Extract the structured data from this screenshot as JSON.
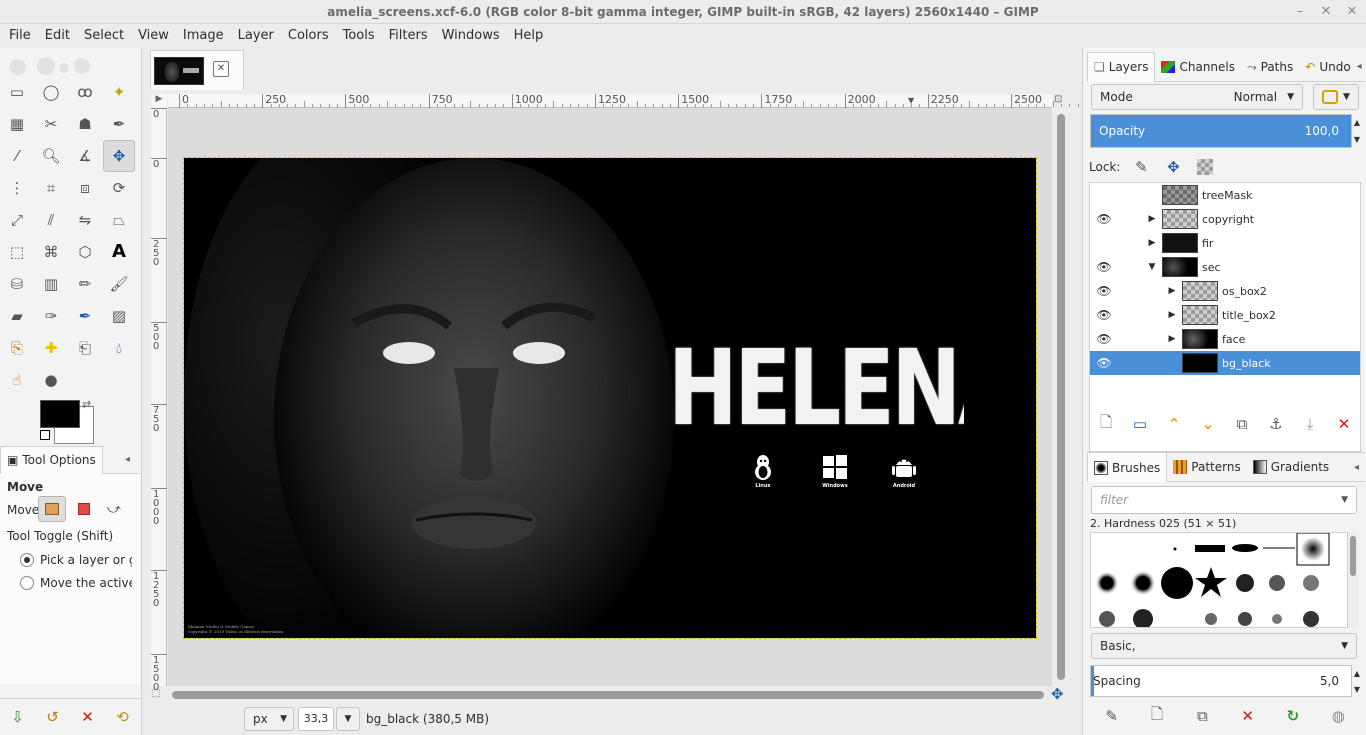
{
  "window": {
    "title": "amelia_screens.xcf-6.0 (RGB color 8-bit gamma integer, GIMP built-in sRGB, 42 layers) 2560x1440 – GIMP",
    "controls": [
      "–",
      "✕",
      "✕"
    ]
  },
  "menubar": [
    "File",
    "Edit",
    "Select",
    "View",
    "Image",
    "Layer",
    "Colors",
    "Tools",
    "Filters",
    "Windows",
    "Help"
  ],
  "toolbox": {
    "tools": [
      "rect-select",
      "ellipse-select",
      "free-select",
      "fuzzy-select",
      "select-by-color",
      "scissors",
      "foreground-select",
      "paths",
      "color-picker",
      "zoom",
      "measure",
      "move",
      "align",
      "crop",
      "unified-transform",
      "rotate",
      "scale",
      "shear",
      "flip",
      "perspective",
      "3d-transform",
      "warp",
      "cage",
      "text",
      "bucket-fill",
      "gradient",
      "pencil",
      "paintbrush",
      "eraser",
      "airbrush",
      "ink",
      "mypaint-brush",
      "clone",
      "heal",
      "perspective-clone",
      "blur",
      "smudge",
      "dodge-burn"
    ],
    "active_tool": "move"
  },
  "tool_options": {
    "tab_label": "Tool Options",
    "title": "Move",
    "move_label": "Move:",
    "toggle_label": "Tool Toggle  (Shift)",
    "options": [
      "Pick a layer or guide",
      "Move the active layer"
    ],
    "selected_option": 0
  },
  "image_tab": {
    "close": "✕"
  },
  "ruler": {
    "h_labels": [
      "0",
      "250",
      "500",
      "750",
      "1000",
      "1250",
      "1500",
      "1750",
      "2000",
      "2250",
      "2500"
    ],
    "v_labels": [
      "0",
      "0",
      "2\n5\n0",
      "5\n0\n0",
      "7\n5\n0",
      "1\n0\n0\n0",
      "1\n2\n5\n0",
      "1\n5\n0\n0"
    ]
  },
  "canvas_image": {
    "title_text": "HELENA",
    "os_labels": [
      "Linux",
      "Windows",
      "Android"
    ],
    "copyright_lines": [
      "Shaman Studio & Mobile Games",
      "copyright © 2019 Todos os direitos reservados."
    ]
  },
  "statusbar": {
    "unit": "px",
    "zoom": "33,3 %",
    "layer_info": "bg_black (380,5 MB)"
  },
  "layers_panel": {
    "tabs": [
      "Layers",
      "Channels",
      "Paths",
      "Undo"
    ],
    "mode_label": "Mode",
    "mode_value": "Normal",
    "opacity_label": "Opacity",
    "opacity_value": "100,0",
    "opacity_fraction": 1.0,
    "lock_label": "Lock:",
    "layers": [
      {
        "name": "treeMask",
        "visible": false,
        "expander": "",
        "indent": 0,
        "thumb": "checker-dark",
        "selected": false
      },
      {
        "name": "copyright",
        "visible": true,
        "expander": "▶",
        "indent": 0,
        "thumb": "checker",
        "selected": false
      },
      {
        "name": "fir",
        "visible": false,
        "expander": "▶",
        "indent": 0,
        "thumb": "dark-logo",
        "selected": false
      },
      {
        "name": "sec",
        "visible": true,
        "expander": "▼",
        "indent": 0,
        "thumb": "dark-face",
        "selected": false
      },
      {
        "name": "os_box2",
        "visible": true,
        "expander": "▶",
        "indent": 1,
        "thumb": "checker",
        "selected": false
      },
      {
        "name": "title_box2",
        "visible": true,
        "expander": "▶",
        "indent": 1,
        "thumb": "checker",
        "selected": false
      },
      {
        "name": "face",
        "visible": true,
        "expander": "▶",
        "indent": 1,
        "thumb": "face",
        "selected": false
      },
      {
        "name": "bg_black",
        "visible": true,
        "expander": "",
        "indent": 1,
        "thumb": "black",
        "selected": true
      }
    ]
  },
  "brushes_panel": {
    "tabs": [
      "Brushes",
      "Patterns",
      "Gradients"
    ],
    "filter_placeholder": "filter",
    "brush_name": "2. Hardness 025 (51 × 51)",
    "preset": "Basic,",
    "spacing_label": "Spacing",
    "spacing_value": "5,0"
  },
  "colors": {
    "accent": "#4a90d9",
    "selection": "#4a90d9",
    "delete_red": "#d01919",
    "anchor_orange": "#f0a000"
  }
}
